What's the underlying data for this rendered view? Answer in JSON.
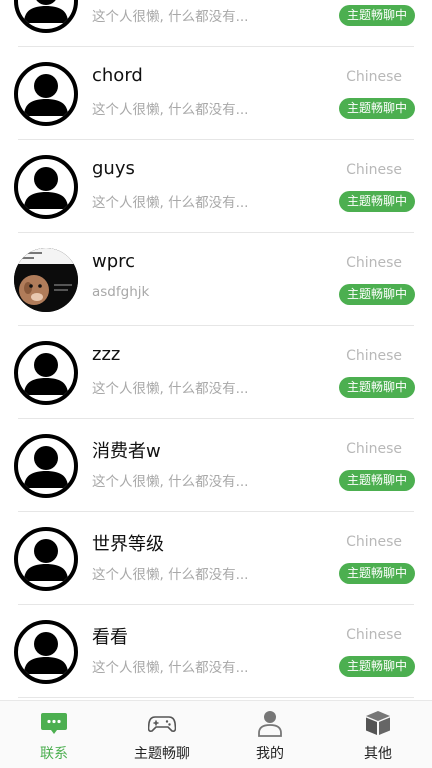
{
  "contacts": [
    {
      "name": "",
      "desc": "这个人很懒, 什么都没有...",
      "lang": "",
      "badge": "主题畅聊中"
    },
    {
      "name": "chord",
      "desc": "这个人很懒, 什么都没有...",
      "lang": "Chinese",
      "badge": "主题畅聊中"
    },
    {
      "name": "guys",
      "desc": "这个人很懒, 什么都没有...",
      "lang": "Chinese",
      "badge": "主题畅聊中"
    },
    {
      "name": "wprc",
      "desc": "asdfghjk",
      "lang": "Chinese",
      "badge": "主题畅聊中"
    },
    {
      "name": "zzz",
      "desc": "这个人很懒, 什么都没有...",
      "lang": "Chinese",
      "badge": "主题畅聊中"
    },
    {
      "name": "消费者w",
      "desc": "这个人很懒, 什么都没有...",
      "lang": "Chinese",
      "badge": "主题畅聊中"
    },
    {
      "name": "世界等级",
      "desc": "这个人很懒, 什么都没有...",
      "lang": "Chinese",
      "badge": "主题畅聊中"
    },
    {
      "name": "看看",
      "desc": "这个人很懒, 什么都没有...",
      "lang": "Chinese",
      "badge": "主题畅聊中"
    }
  ],
  "tabs": [
    {
      "label": "联系",
      "icon": "chat-bubble-icon",
      "active": true
    },
    {
      "label": "主题畅聊",
      "icon": "gamepad-icon",
      "active": false
    },
    {
      "label": "我的",
      "icon": "person-icon",
      "active": false
    },
    {
      "label": "其他",
      "icon": "box-icon",
      "active": false
    }
  ],
  "colors": {
    "accent": "#4caf50",
    "muted": "#a8a8a8"
  }
}
